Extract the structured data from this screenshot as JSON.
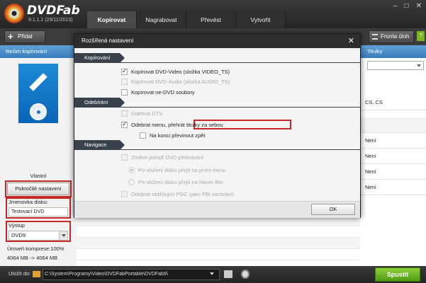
{
  "app": {
    "logo": "DVDFab",
    "version": "9.1.1.1 (29/11/2013)"
  },
  "tabs": [
    {
      "label": "Kopírovat"
    },
    {
      "label": "Nagrabovat"
    },
    {
      "label": "Převést"
    },
    {
      "label": "Vytvořit"
    }
  ],
  "window_controls": {
    "minimize": "–",
    "maximize": "□",
    "close": "✕"
  },
  "toolbar": {
    "add_label": "Přidat",
    "queue_label": "Fronta úloh",
    "help_label": "?"
  },
  "left_panel": {
    "mode_label": "Režim kopírování",
    "mode_value": "Vlastní",
    "advanced_button": "Pokročilé nastavení",
    "volume_label": "Jmenovka disku:",
    "volume_value": "Testovací DVD",
    "output_label": "Výstup",
    "output_value": "DVD9",
    "compression": "Úroveň komprese:100%",
    "sizes": "4064 MB -> 4064 MB"
  },
  "main": {
    "subtitles_header": "Titulky",
    "rows": [
      "CS, CS",
      "Není",
      "Není",
      "Není",
      "Není"
    ]
  },
  "bottom": {
    "save_label": "Uložit do:",
    "path": "C:\\System\\Programy\\Video\\DVDFabPortable\\DVDFab9\\",
    "start_label": "Spustit"
  },
  "dialog": {
    "title": "Rozšířená nastavení",
    "close": "✕",
    "sections": {
      "copy": "Kopírování",
      "remove": "Odebírání",
      "nav": "Navigace"
    },
    "copy_options": [
      {
        "label": "Kopírovat DVD-Video (složka VIDEO_TS)",
        "checked": true,
        "disabled": false
      },
      {
        "label": "Kopírovat DVD-Audio (složka AUDIO_TS)",
        "checked": false,
        "disabled": true
      },
      {
        "label": "Kopírovat ne-DVD soubory",
        "checked": false,
        "disabled": false
      }
    ],
    "remove_options": [
      {
        "label": "Odebrat DTS",
        "checked": false,
        "disabled": true
      },
      {
        "label": "Odebrat menu, přehrát titulky za sebou",
        "checked": true,
        "disabled": false
      },
      {
        "label": "Na konci převinout zpět",
        "checked": false,
        "disabled": false
      }
    ],
    "nav_options": {
      "change_order": "Změnit pořadí DVD přehrávání",
      "radio_first": "Po vložení disku přejít na první menu",
      "radio_main": "Po vložení disku přejít na hlavní film",
      "remove_pgc": "Odebrat obtěžující PGC (jako FBI varování)"
    },
    "ok": "OK"
  }
}
